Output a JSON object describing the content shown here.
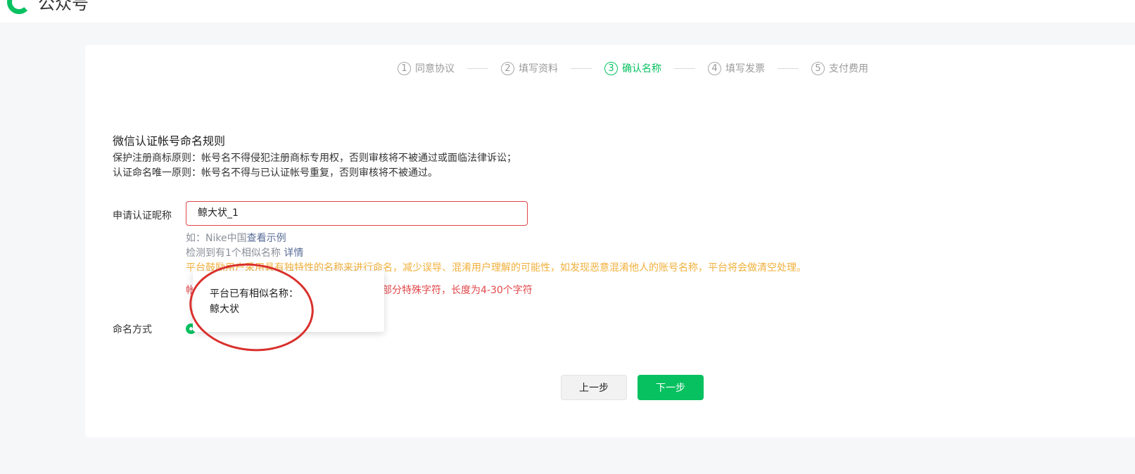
{
  "header": {
    "brand": "公众号",
    "logo_icon": "wechat-logo-icon"
  },
  "steps": [
    {
      "num": "1",
      "label": "同意协议",
      "active": false
    },
    {
      "num": "2",
      "label": "填写资料",
      "active": false
    },
    {
      "num": "3",
      "label": "确认名称",
      "active": true
    },
    {
      "num": "4",
      "label": "填写发票",
      "active": false
    },
    {
      "num": "5",
      "label": "支付费用",
      "active": false
    }
  ],
  "rules": {
    "title": "微信认证帐号命名规则",
    "rule1": "保护注册商标原则：帐号名不得侵犯注册商标专用权，否则审核将不被通过或面临法律诉讼；",
    "rule2": "认证命名唯一原则：帐号名不得与已认证帐号重复，否则审核将不被通过。"
  },
  "form": {
    "nickname_label": "申请认证昵称",
    "nickname_value": "鲸大状_1",
    "hint_example_prefix": "如：Nike中国",
    "hint_example_link": "查看示例",
    "hint_similar_prefix": "检测到有1个相似名称 ",
    "hint_similar_link": "详情",
    "warning": "平台鼓励用户采用具有独特性的名称来进行命名，减少误导、混淆用户理解的可能性，如发现恶意混淆他人的账号名称，平台将会做清空处理。",
    "error_left": "帐",
    "error_right": "部分特殊字符，长度为4-30个字符",
    "method_label": "命名方式"
  },
  "popover": {
    "title": "平台已有相似名称：",
    "name": "鲸大状"
  },
  "buttons": {
    "prev": "上一步",
    "next": "下一步"
  },
  "colors": {
    "accent": "#07c160",
    "error": "#e0474a",
    "warning": "#f0b03c",
    "link": "#576b95"
  }
}
